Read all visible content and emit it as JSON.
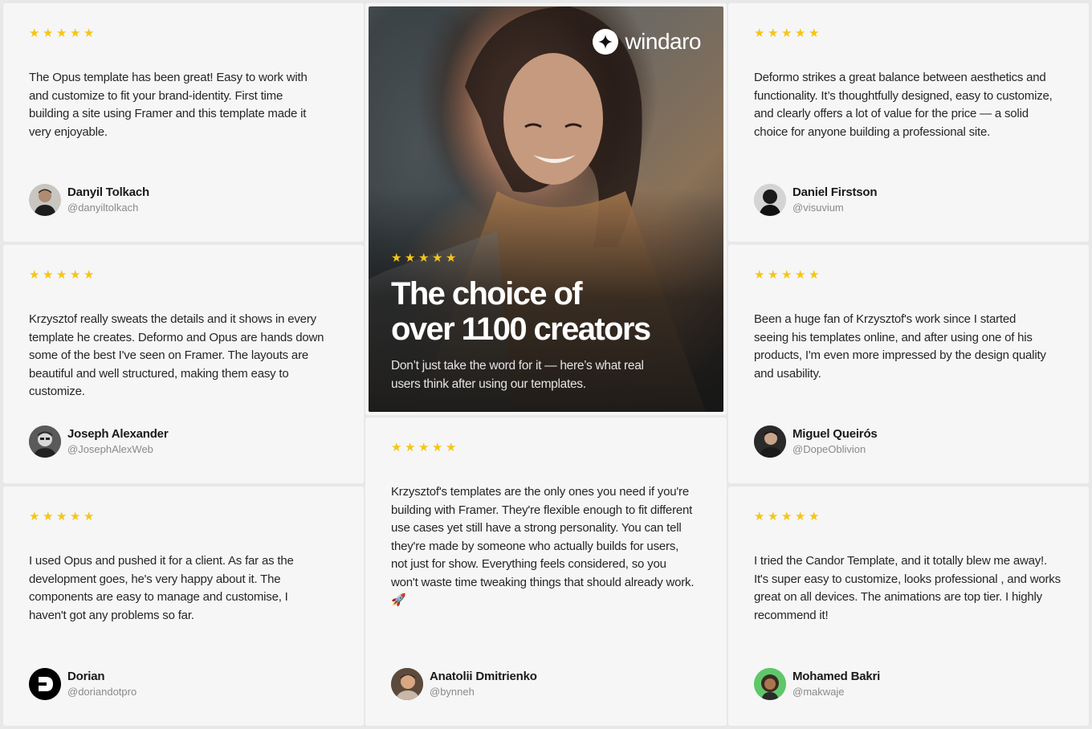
{
  "colors": {
    "star": "#f5c518",
    "card_bg": "#f6f6f6",
    "page_bg": "#e8e8e8"
  },
  "rating_glyph": "★",
  "hero": {
    "brand": "windaro",
    "rating_stars": 5,
    "title_line1": "The choice of",
    "title_line2": "over 1100 creators",
    "subtitle": "Don’t just take the word for it — here’s what real users think after using our templates."
  },
  "testimonials": [
    {
      "stars": 5,
      "quote": "The Opus template has been great! Easy to work with and customize to fit your brand-identity. First time building a site using Framer and this template made it very enjoyable.",
      "name": "Danyil Tolkach",
      "handle": "@danyiltolkach"
    },
    {
      "stars": 5,
      "quote": "Deformo strikes a great balance between aesthetics and functionality. It’s thoughtfully designed, easy to customize, and clearly offers a lot of value for the price — a solid choice for anyone building a professional site.",
      "name": "Daniel Firstson",
      "handle": "@visuvium"
    },
    {
      "stars": 5,
      "quote": "Krzysztof really sweats the details and it shows in every template he creates. Deformo and Opus are hands down some of the best I've seen on Framer. The layouts are beautiful and well structured, making them easy to customize.",
      "name": "Joseph Alexander",
      "handle": "@JosephAlexWeb"
    },
    {
      "stars": 5,
      "quote": "Been a huge fan of Krzysztof's work since I started seeing his templates online, and after using one of his products, I'm even more impressed by the design quality and usability.",
      "name": "Miguel Queirós",
      "handle": "@DopeOblivion"
    },
    {
      "stars": 5,
      "quote": "I used Opus and pushed it for a client. As far as the development goes, he's very happy about it. The components are easy to manage and customise, I haven't got any problems so far.",
      "name": "Dorian",
      "handle": "@doriandotpro"
    },
    {
      "stars": 5,
      "quote": "Krzysztof's templates are the only ones you need if you're building with Framer. They're flexible enough to fit different use cases yet still have a strong personality. You can tell they're made by someone who actually builds for users, not just for show. Everything feels considered, so you won't waste time tweaking things that should already work. 🚀",
      "name": "Anatolii Dmitrienko",
      "handle": "@bynneh"
    },
    {
      "stars": 5,
      "quote": "I tried the Candor Template, and it totally blew me away!. It's super easy to customize, looks professional , and works great on all devices. The animations are top tier. I highly recommend it!",
      "name": "Mohamed Bakri",
      "handle": "@makwaje"
    }
  ]
}
